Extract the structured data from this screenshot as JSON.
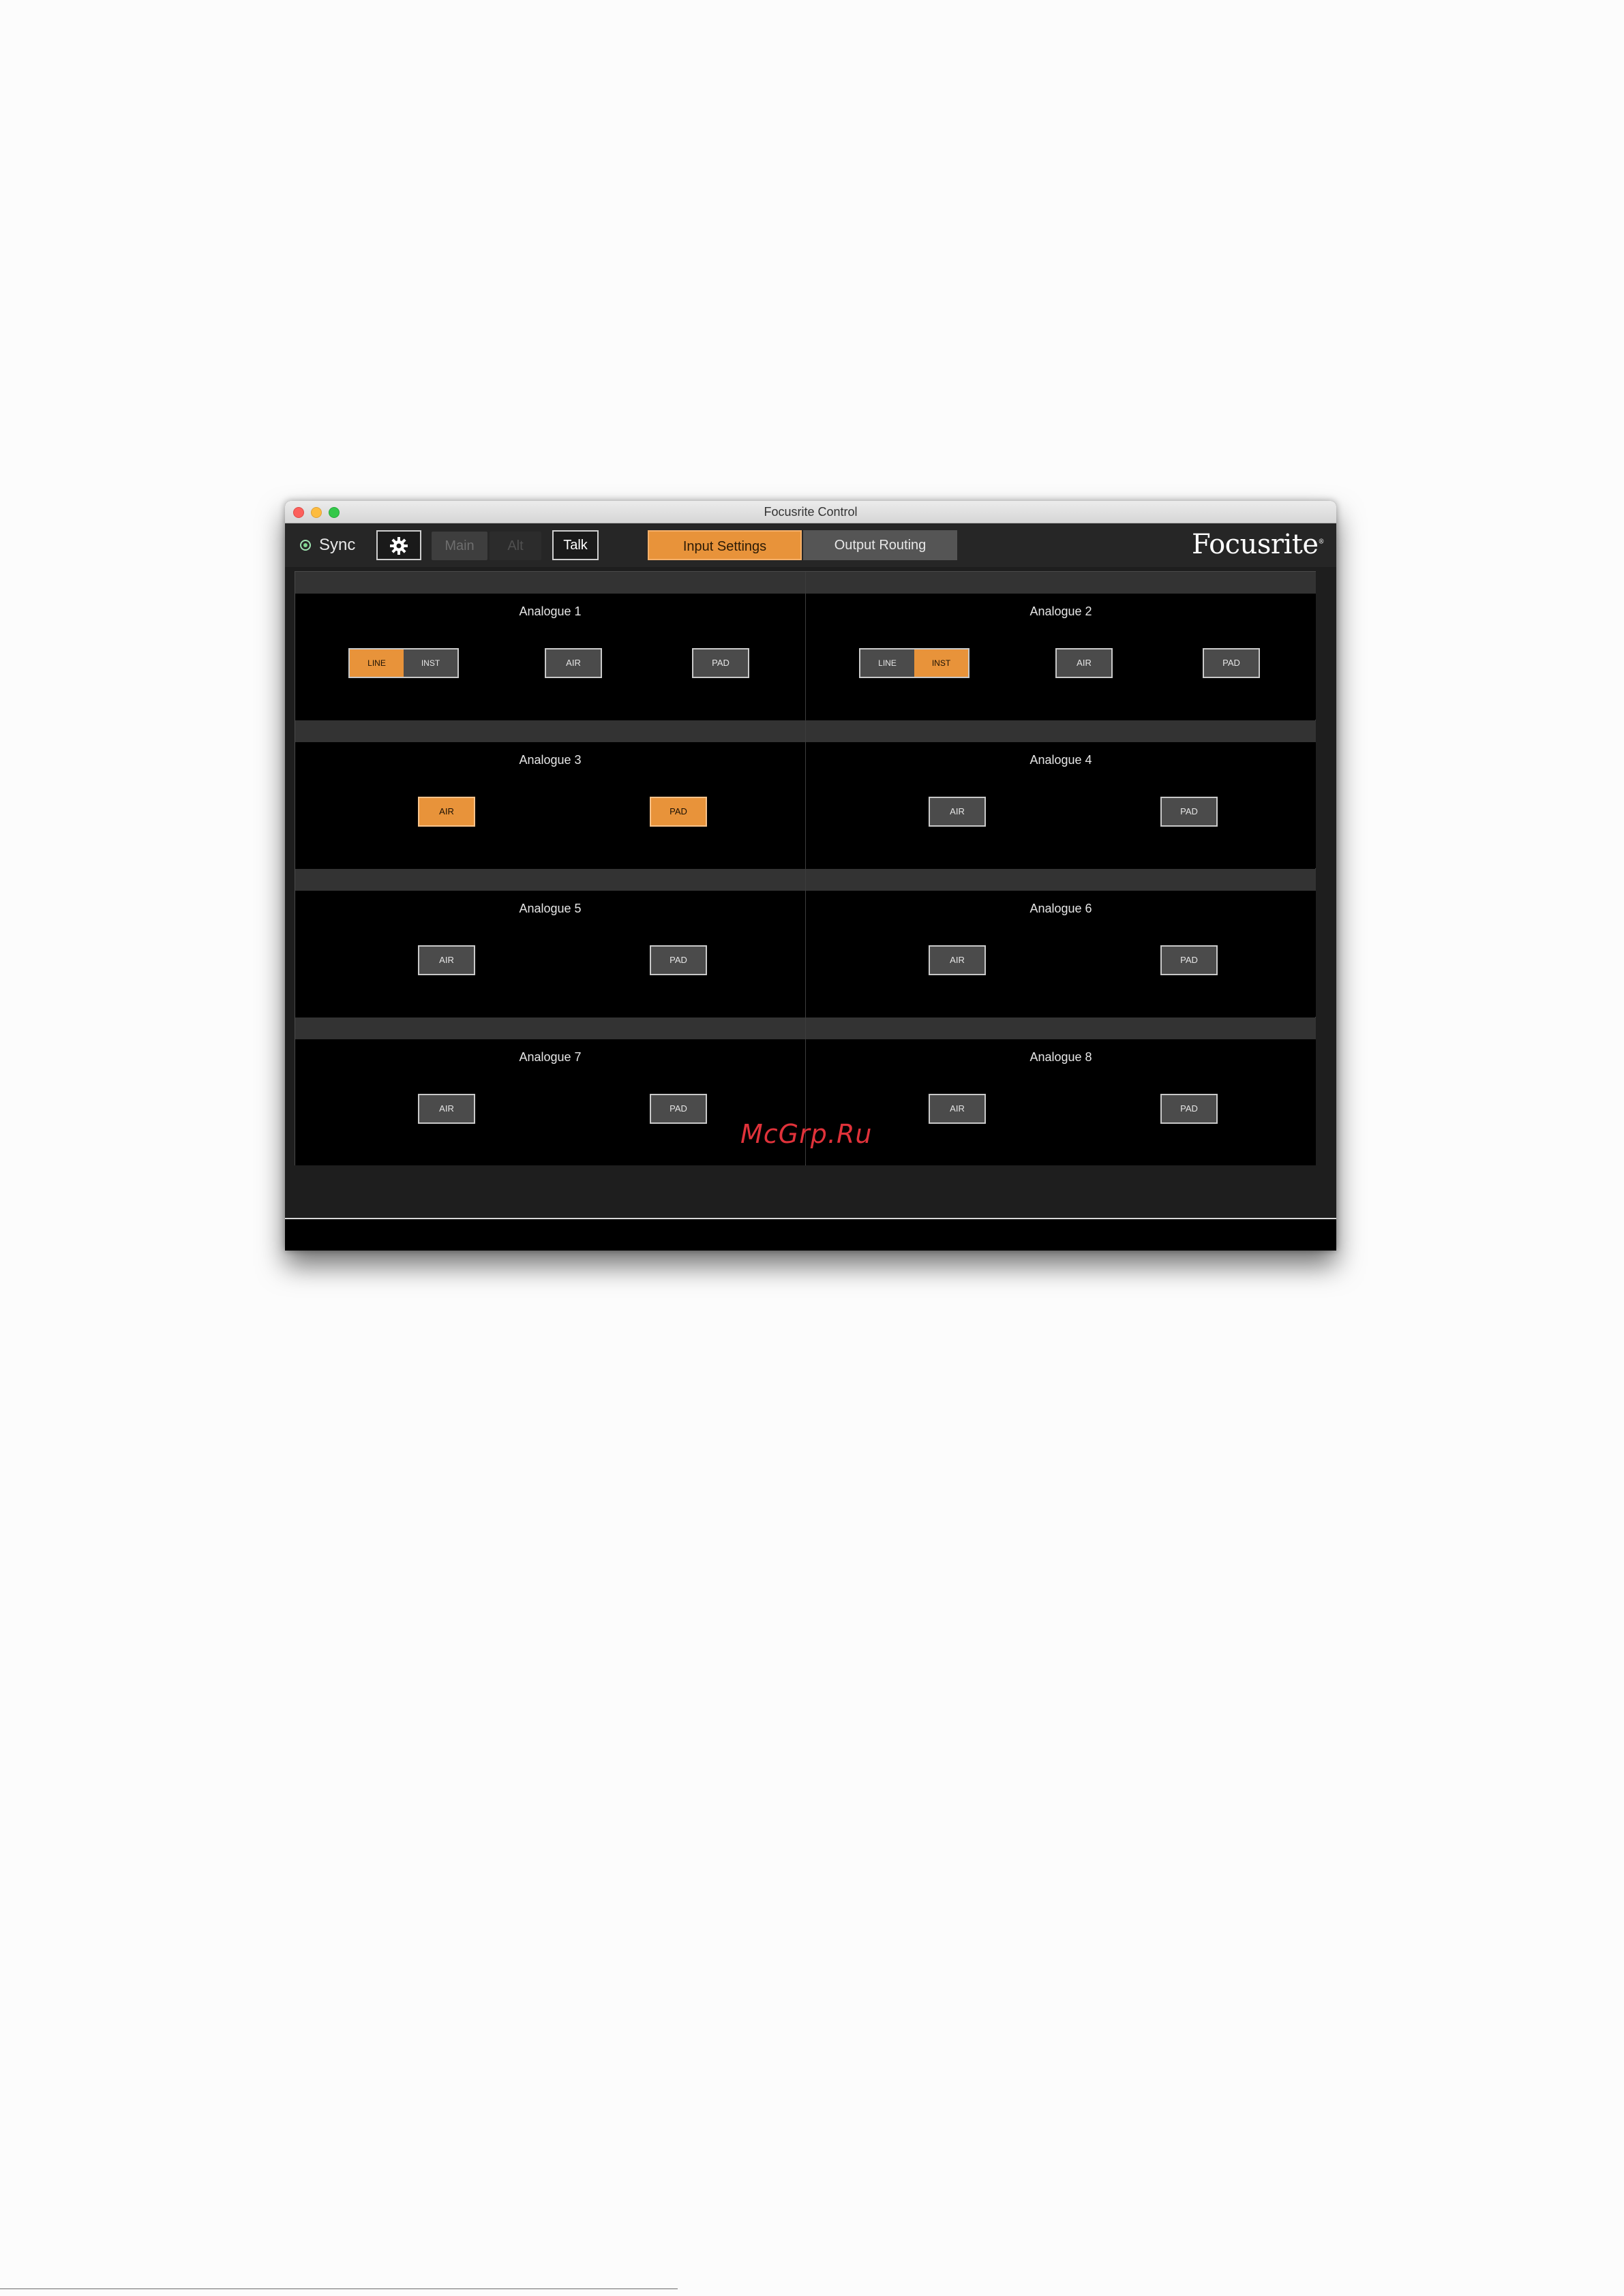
{
  "window": {
    "title": "Focusrite Control"
  },
  "toolbar": {
    "sync_label": "Sync",
    "main_label": "Main",
    "alt_label": "Alt",
    "talk_label": "Talk",
    "tabs": [
      {
        "label": "Input Settings",
        "active": true
      },
      {
        "label": "Output Routing",
        "active": false
      }
    ],
    "logo": "Focusrite",
    "logo_mark": "®"
  },
  "colors": {
    "accent": "#e8933a",
    "sync_indicator": "#7fd98f",
    "button_off": "#4b4b4b",
    "panel_header": "#333333"
  },
  "icons": {
    "sync": "status-dot-icon",
    "settings": "gear-icon"
  },
  "channels": [
    {
      "name": "Analogue 1",
      "line": "LINE",
      "inst": "INST",
      "mode": "LINE",
      "air": "AIR",
      "air_on": false,
      "pad": "PAD",
      "pad_on": false
    },
    {
      "name": "Analogue 2",
      "line": "LINE",
      "inst": "INST",
      "mode": "INST",
      "air": "AIR",
      "air_on": false,
      "pad": "PAD",
      "pad_on": false
    },
    {
      "name": "Analogue 3",
      "air": "AIR",
      "air_on": true,
      "pad": "PAD",
      "pad_on": true
    },
    {
      "name": "Analogue 4",
      "air": "AIR",
      "air_on": false,
      "pad": "PAD",
      "pad_on": false
    },
    {
      "name": "Analogue 5",
      "air": "AIR",
      "air_on": false,
      "pad": "PAD",
      "pad_on": false
    },
    {
      "name": "Analogue 6",
      "air": "AIR",
      "air_on": false,
      "pad": "PAD",
      "pad_on": false
    },
    {
      "name": "Analogue 7",
      "air": "AIR",
      "air_on": false,
      "pad": "PAD",
      "pad_on": false
    },
    {
      "name": "Analogue 8",
      "air": "AIR",
      "air_on": false,
      "pad": "PAD",
      "pad_on": false
    }
  ],
  "watermark": "McGrp.Ru"
}
